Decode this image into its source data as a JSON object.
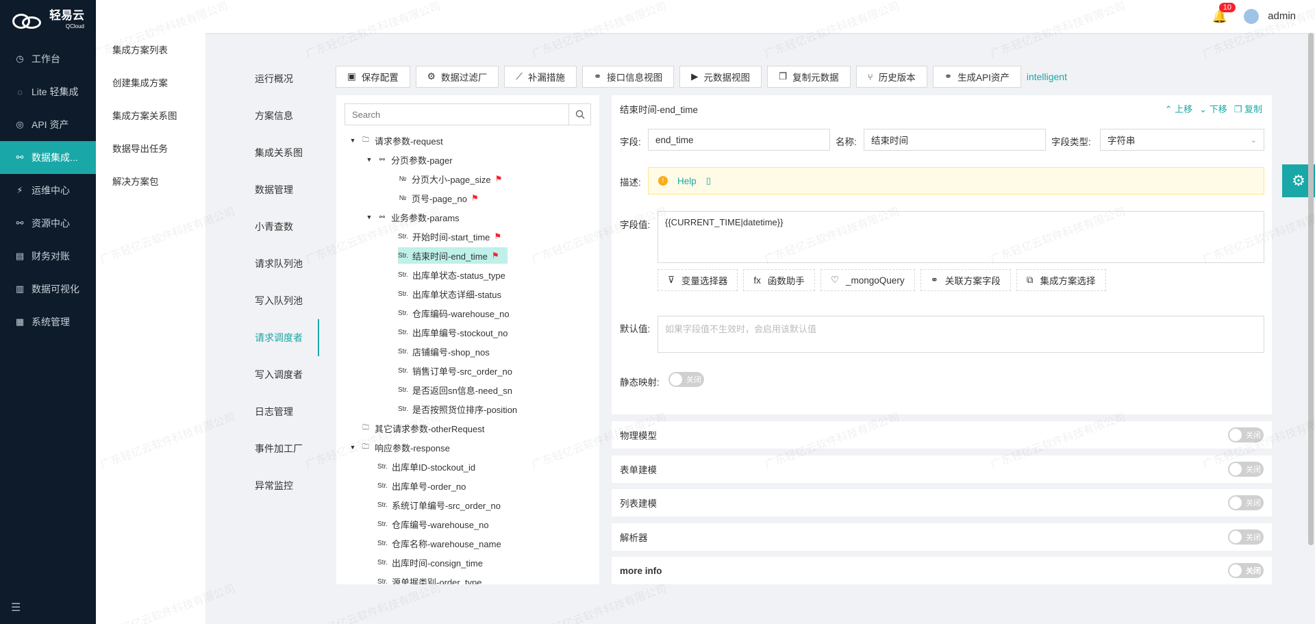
{
  "logo": {
    "name": "轻易云",
    "sub": "QCloud"
  },
  "nav": [
    {
      "icon": "◷",
      "label": "工作台"
    },
    {
      "icon": "◌",
      "label": "Lite 轻集成"
    },
    {
      "icon": "◎",
      "label": "API 资产"
    },
    {
      "icon": "⚯",
      "label": "数据集成..."
    },
    {
      "icon": "⚡",
      "label": "运维中心"
    },
    {
      "icon": "⚯",
      "label": "资源中心"
    },
    {
      "icon": "▤",
      "label": "财务对账"
    },
    {
      "icon": "▥",
      "label": "数据可视化"
    },
    {
      "icon": "▦",
      "label": "系统管理"
    }
  ],
  "header": {
    "notifications": "10",
    "user": "admin"
  },
  "subnav": [
    "集成方案列表",
    "创建集成方案",
    "集成方案关系图",
    "数据导出任务",
    "解决方案包"
  ],
  "tabs": [
    "运行概况",
    "方案信息",
    "集成关系图",
    "数据管理",
    "小青查数",
    "请求队列池",
    "写入队列池",
    "请求调度者",
    "写入调度者",
    "日志管理",
    "事件加工厂",
    "异常监控"
  ],
  "toolbar": {
    "buttons": [
      {
        "icon": "▣",
        "label": "保存配置"
      },
      {
        "icon": "⚙",
        "label": "数据过滤厂"
      },
      {
        "icon": "⟋",
        "label": "补漏措施"
      },
      {
        "icon": "⚭",
        "label": "接口信息视图"
      },
      {
        "icon": "▶",
        "label": "元数据视图"
      },
      {
        "icon": "❐",
        "label": "复制元数据"
      },
      {
        "icon": "⑂",
        "label": "历史版本"
      },
      {
        "icon": "⚭",
        "label": "生成API资产"
      }
    ],
    "link": "intelligent"
  },
  "tree": {
    "search_placeholder": "Search",
    "nodes": [
      {
        "indent": 0,
        "arrow": "▼",
        "icon": "🗀",
        "label": "请求参数-request",
        "flag": false
      },
      {
        "indent": 1,
        "arrow": "▼",
        "icon": "⚯",
        "label": "分页参数-pager",
        "flag": false
      },
      {
        "indent": 2,
        "arrow": "",
        "icon": "№",
        "label": "分页大小-page_size",
        "flag": true
      },
      {
        "indent": 2,
        "arrow": "",
        "icon": "№",
        "label": "页号-page_no",
        "flag": true
      },
      {
        "indent": 1,
        "arrow": "▼",
        "icon": "⚯",
        "label": "业务参数-params",
        "flag": false
      },
      {
        "indent": 2,
        "arrow": "",
        "icon": "Str.",
        "label": "开始时间-start_time",
        "flag": true
      },
      {
        "indent": 2,
        "arrow": "",
        "icon": "Str.",
        "label": "结束时间-end_time",
        "flag": true,
        "selected": true
      },
      {
        "indent": 2,
        "arrow": "",
        "icon": "Str.",
        "label": "出库单状态-status_type",
        "flag": false
      },
      {
        "indent": 2,
        "arrow": "",
        "icon": "Str.",
        "label": "出库单状态详细-status",
        "flag": false
      },
      {
        "indent": 2,
        "arrow": "",
        "icon": "Str.",
        "label": "仓库编码-warehouse_no",
        "flag": false
      },
      {
        "indent": 2,
        "arrow": "",
        "icon": "Str.",
        "label": "出库单编号-stockout_no",
        "flag": false
      },
      {
        "indent": 2,
        "arrow": "",
        "icon": "Str.",
        "label": "店铺编号-shop_nos",
        "flag": false
      },
      {
        "indent": 2,
        "arrow": "",
        "icon": "Str.",
        "label": "销售订单号-src_order_no",
        "flag": false
      },
      {
        "indent": 2,
        "arrow": "",
        "icon": "Str.",
        "label": "是否返回sn信息-need_sn",
        "flag": false
      },
      {
        "indent": 2,
        "arrow": "",
        "icon": "Str.",
        "label": "是否按照货位排序-position",
        "flag": false
      },
      {
        "indent": 0,
        "arrow": "",
        "icon": "🗀",
        "label": "其它请求参数-otherRequest",
        "flag": false
      },
      {
        "indent": 0,
        "arrow": "▼",
        "icon": "🗀",
        "label": "响应参数-response",
        "flag": false
      },
      {
        "indent": 1,
        "arrow": "",
        "icon": "Str.",
        "label": "出库单ID-stockout_id",
        "flag": false
      },
      {
        "indent": 1,
        "arrow": "",
        "icon": "Str.",
        "label": "出库单号-order_no",
        "flag": false
      },
      {
        "indent": 1,
        "arrow": "",
        "icon": "Str.",
        "label": "系统订单编号-src_order_no",
        "flag": false
      },
      {
        "indent": 1,
        "arrow": "",
        "icon": "Str.",
        "label": "仓库编号-warehouse_no",
        "flag": false
      },
      {
        "indent": 1,
        "arrow": "",
        "icon": "Str.",
        "label": "仓库名称-warehouse_name",
        "flag": false
      },
      {
        "indent": 1,
        "arrow": "",
        "icon": "Str.",
        "label": "出库时间-consign_time",
        "flag": false
      },
      {
        "indent": 1,
        "arrow": "",
        "icon": "Str.",
        "label": "源单据类别-order_type",
        "flag": false
      }
    ]
  },
  "detail": {
    "title": "结束时间-end_time",
    "actions": {
      "up": "上移",
      "down": "下移",
      "copy": "复制"
    },
    "field_label": "字段:",
    "field_value": "end_time",
    "name_label": "名称:",
    "name_value": "结束时间",
    "type_label": "字段类型:",
    "type_value": "字符串",
    "desc_label": "描述:",
    "help": "Help",
    "value_label": "字段值:",
    "value": "{{CURRENT_TIME|datetime}}",
    "chips": [
      {
        "icon": "⊽",
        "label": "变量选择器"
      },
      {
        "icon": "fx",
        "label": "函数助手"
      },
      {
        "icon": "♡",
        "label": "_mongoQuery"
      },
      {
        "icon": "⚭",
        "label": "关联方案字段"
      },
      {
        "icon": "⧉",
        "label": "集成方案选择"
      }
    ],
    "default_label": "默认值:",
    "default_placeholder": "如果字段值不生效时，会启用该默认值",
    "static_label": "静态映射:",
    "switch_off": "关闭"
  },
  "sections": [
    "物理模型",
    "表单建模",
    "列表建模",
    "解析器",
    "more info"
  ],
  "watermark": "广东轻亿云软件科技有限公司"
}
